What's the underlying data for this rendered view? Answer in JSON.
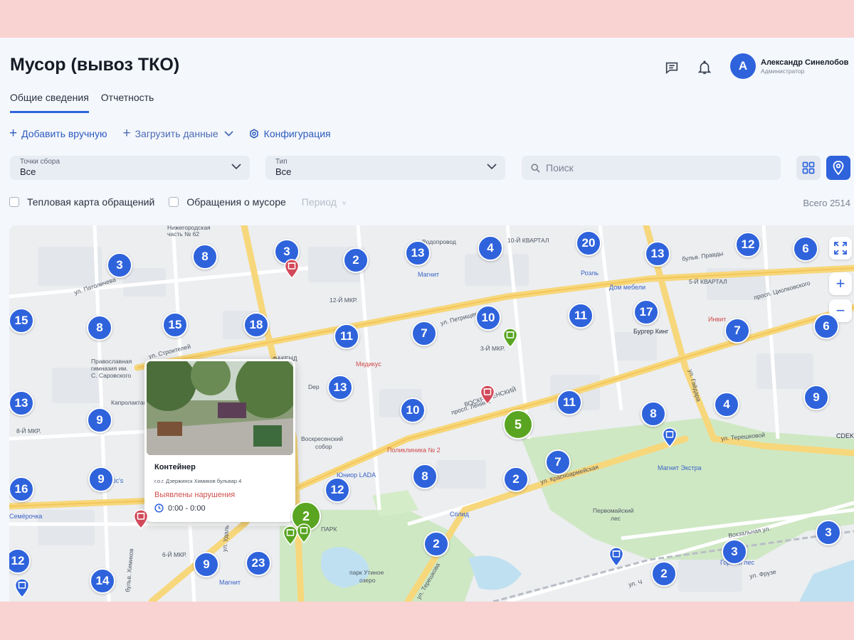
{
  "header": {
    "title": "Мусор (вывоз ТКО)",
    "user": {
      "initial": "А",
      "name": "Александр Синелобов",
      "role": "Администратор"
    }
  },
  "tabs": [
    {
      "label": "Общие сведения",
      "active": true
    },
    {
      "label": "Отчетность",
      "active": false
    }
  ],
  "actions": {
    "add_manual": "Добавить вручную",
    "upload_data": "Загрузить данные",
    "configuration": "Конфигурация"
  },
  "filters": {
    "points": {
      "label": "Точки сбора",
      "value": "Все"
    },
    "type": {
      "label": "Тип",
      "value": "Все"
    },
    "search": {
      "placeholder": "Поиск"
    },
    "heatmap_label": "Тепловая карта обращений",
    "waste_requests_label": "Обращения о мусоре",
    "period_label": "Период",
    "total": "Всего 2514"
  },
  "map": {
    "labels": [
      "ул. Патоличева",
      "12-Й МКР.",
      "8-Й МКР.",
      "ул. Строителей",
      "Православная",
      "гимназия им.",
      "С. Саровского",
      "Капролактамовец",
      "ул. Петрищева",
      "3-Й МКР.",
      "просп. Ленина",
      "ул. Гайдара",
      "ул. Терешковой",
      "5-Й КВАРТАЛ",
      "10-Й КВАРТАЛ",
      "бульв. Правды",
      "просп. Циолковского",
      "Первомайский",
      "лес",
      "парк Утиное",
      "озеро",
      "ул. Терешкова",
      "ул. Красноармейская",
      "Вокзальная ул.",
      "ул. Фрузе",
      "ВОСКРЕСЕНСКИЙ",
      "Воскресенский",
      "собор",
      "6-Й МКР.",
      "ул. Удаль",
      "бульв. Химиков",
      "Нижегородская",
      "часть № 62",
      "ПАРК",
      "Dep",
      "ФАКЕНД",
      "Водопровод",
      "ул. Ч"
    ],
    "pois": [
      "Магнит",
      "Роэль",
      "Дом мебели",
      "Бургер Кинг",
      "Медикус",
      "Поликлиника № 2",
      "Юниор LADA",
      "Магнит Экстра",
      "Солид",
      "Магнит",
      "Горный лес",
      "Инвит",
      "Fostic's",
      "Семёрочка",
      "CDEK"
    ],
    "clusters": [
      "3",
      "8",
      "3",
      "2",
      "13",
      "4",
      "20",
      "13",
      "12",
      "6",
      "15",
      "8",
      "15",
      "18",
      "11",
      "7",
      "10",
      "11",
      "17",
      "7",
      "6",
      "13",
      "9",
      "13",
      "10",
      "11",
      "8",
      "4",
      "9",
      "16",
      "9",
      "12",
      "8",
      "2",
      "7",
      "14",
      "12",
      "9",
      "23",
      "2",
      "2",
      "3",
      "3",
      "5",
      "2"
    ]
  },
  "popup": {
    "title": "Контейнер",
    "address": "г.о.г. Дзержинск Химиков бульвар 4",
    "violation": "Выявлены нарушения",
    "time": "0:00 - 0:00"
  },
  "colors": {
    "primary": "#2e63dc",
    "cluster_green": "#59a521",
    "violation": "#d0504e",
    "pin_red": "#d24a5a"
  }
}
